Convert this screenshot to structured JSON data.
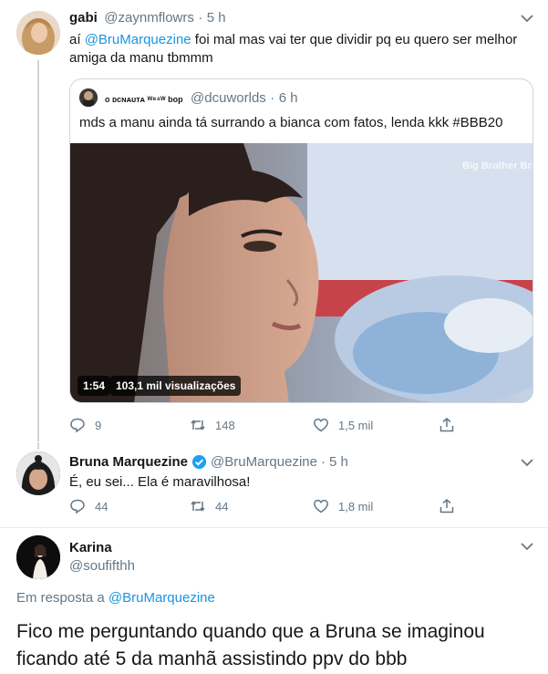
{
  "tweet1": {
    "name": "gabi",
    "handle": "@zaynmflowrs",
    "sep": "·",
    "time": "5 h",
    "text_prefix": "aí ",
    "mention": "@BruMarquezine",
    "text_rest": " foi mal mas vai ter que dividir pq eu quero ser melhor",
    "text_line2": "amiga da manu tbmmm",
    "quote": {
      "name": "o ᴅᴄɴᴀᴜᴛᴀ ᵂ⁸⁴ᵂ bop",
      "handle": "@dcuworlds",
      "sep": "·",
      "time": "6 h",
      "text": "mds a manu ainda tá surrando a bianca com fatos, lenda kkk #BBB20",
      "video_watermark": "Big Brother Brasil",
      "duration": "1:54",
      "views": "103,1 mil visualizações"
    },
    "actions": {
      "reply": "9",
      "retweet": "148",
      "like": "1,5 mil"
    }
  },
  "tweet2": {
    "name": "Bruna Marquezine",
    "handle": "@BruMarquezine",
    "sep": "·",
    "time": "5 h",
    "text": "É, eu sei... Ela é maravilhosa!",
    "actions": {
      "reply": "44",
      "retweet": "44",
      "like": "1,8 mil"
    }
  },
  "tweet3": {
    "name": "Karina",
    "handle": "@soufifthh",
    "reply_prefix": "Em resposta a ",
    "reply_mention": "@BruMarquezine",
    "text_line1": "Fico me perguntando quando que a Bruna se imaginou",
    "text_line2": "ficando até 5 da manhã assistindo ppv do bbb"
  },
  "colors": {
    "accent": "#1b95e0",
    "muted": "#657786",
    "verified": "#1da1f2",
    "border": "#ccd6dd"
  }
}
